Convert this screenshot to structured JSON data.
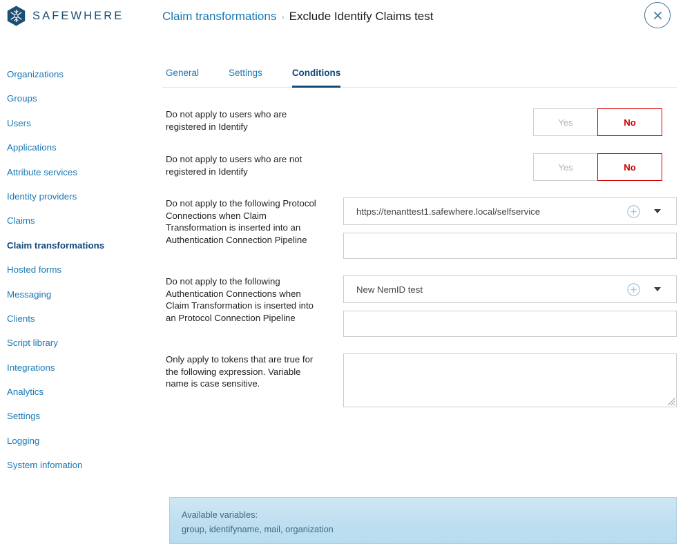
{
  "brand": {
    "name": "SAFEWHERE",
    "logo_icon": "snowflake-hexagon-logo"
  },
  "header": {
    "breadcrumb_parent": "Claim transformations",
    "breadcrumb_separator": "›",
    "breadcrumb_current": "Exclude Identify Claims test",
    "close_icon": "close-x-icon"
  },
  "sidebar": {
    "items": [
      {
        "label": "Organizations",
        "active": false
      },
      {
        "label": "Groups",
        "active": false
      },
      {
        "label": "Users",
        "active": false
      },
      {
        "label": "Applications",
        "active": false
      },
      {
        "label": "Attribute services",
        "active": false
      },
      {
        "label": "Identity providers",
        "active": false
      },
      {
        "label": "Claims",
        "active": false
      },
      {
        "label": "Claim transformations",
        "active": true
      },
      {
        "label": "Hosted forms",
        "active": false
      },
      {
        "label": "Messaging",
        "active": false
      },
      {
        "label": "Clients",
        "active": false
      },
      {
        "label": "Script library",
        "active": false
      },
      {
        "label": "Integrations",
        "active": false
      },
      {
        "label": "Analytics",
        "active": false
      },
      {
        "label": "Settings",
        "active": false
      },
      {
        "label": "Logging",
        "active": false
      },
      {
        "label": "System infomation",
        "active": false
      }
    ]
  },
  "tabs": [
    {
      "label": "General",
      "active": false
    },
    {
      "label": "Settings",
      "active": false
    },
    {
      "label": "Conditions",
      "active": true
    }
  ],
  "form": {
    "row1": {
      "label": "Do not apply to users who are registered in Identify",
      "yes_label": "Yes",
      "no_label": "No",
      "selected": "No"
    },
    "row2": {
      "label": "Do not apply to users who are not registered in Identify",
      "yes_label": "Yes",
      "no_label": "No",
      "selected": "No"
    },
    "row3": {
      "label": "Do not apply to the following Protocol Connections when Claim Transformation is inserted into an Authentication Connection Pipeline",
      "select_value": "https://tenanttest1.safewhere.local/selfservice",
      "add_icon": "plus-circle-icon",
      "caret_icon": "chevron-down-icon",
      "extra_input_value": "",
      "extra_input_placeholder": ""
    },
    "row4": {
      "label": "Do not apply to the following Authentication Connections when Claim Transformation is inserted into an Protocol Connection Pipeline",
      "select_value": "New NemID test",
      "add_icon": "plus-circle-icon",
      "caret_icon": "chevron-down-icon",
      "extra_input_value": "",
      "extra_input_placeholder": ""
    },
    "row5": {
      "label": "Only apply to tokens that are true for the following expression. Variable name is case sensitive.",
      "textarea_value": "",
      "textarea_placeholder": "",
      "resize_icon": "resize-grip-icon"
    }
  },
  "info_panel": {
    "title": "Available variables:",
    "variables": "group, identifyname, mail, organization"
  },
  "colors": {
    "brand_blue": "#1b4f73",
    "link_blue": "#1978b3",
    "active_blue": "#10477a",
    "danger_red": "#cc0000",
    "info_bg": "#c6e3f1",
    "border_gray": "#cccccc"
  }
}
